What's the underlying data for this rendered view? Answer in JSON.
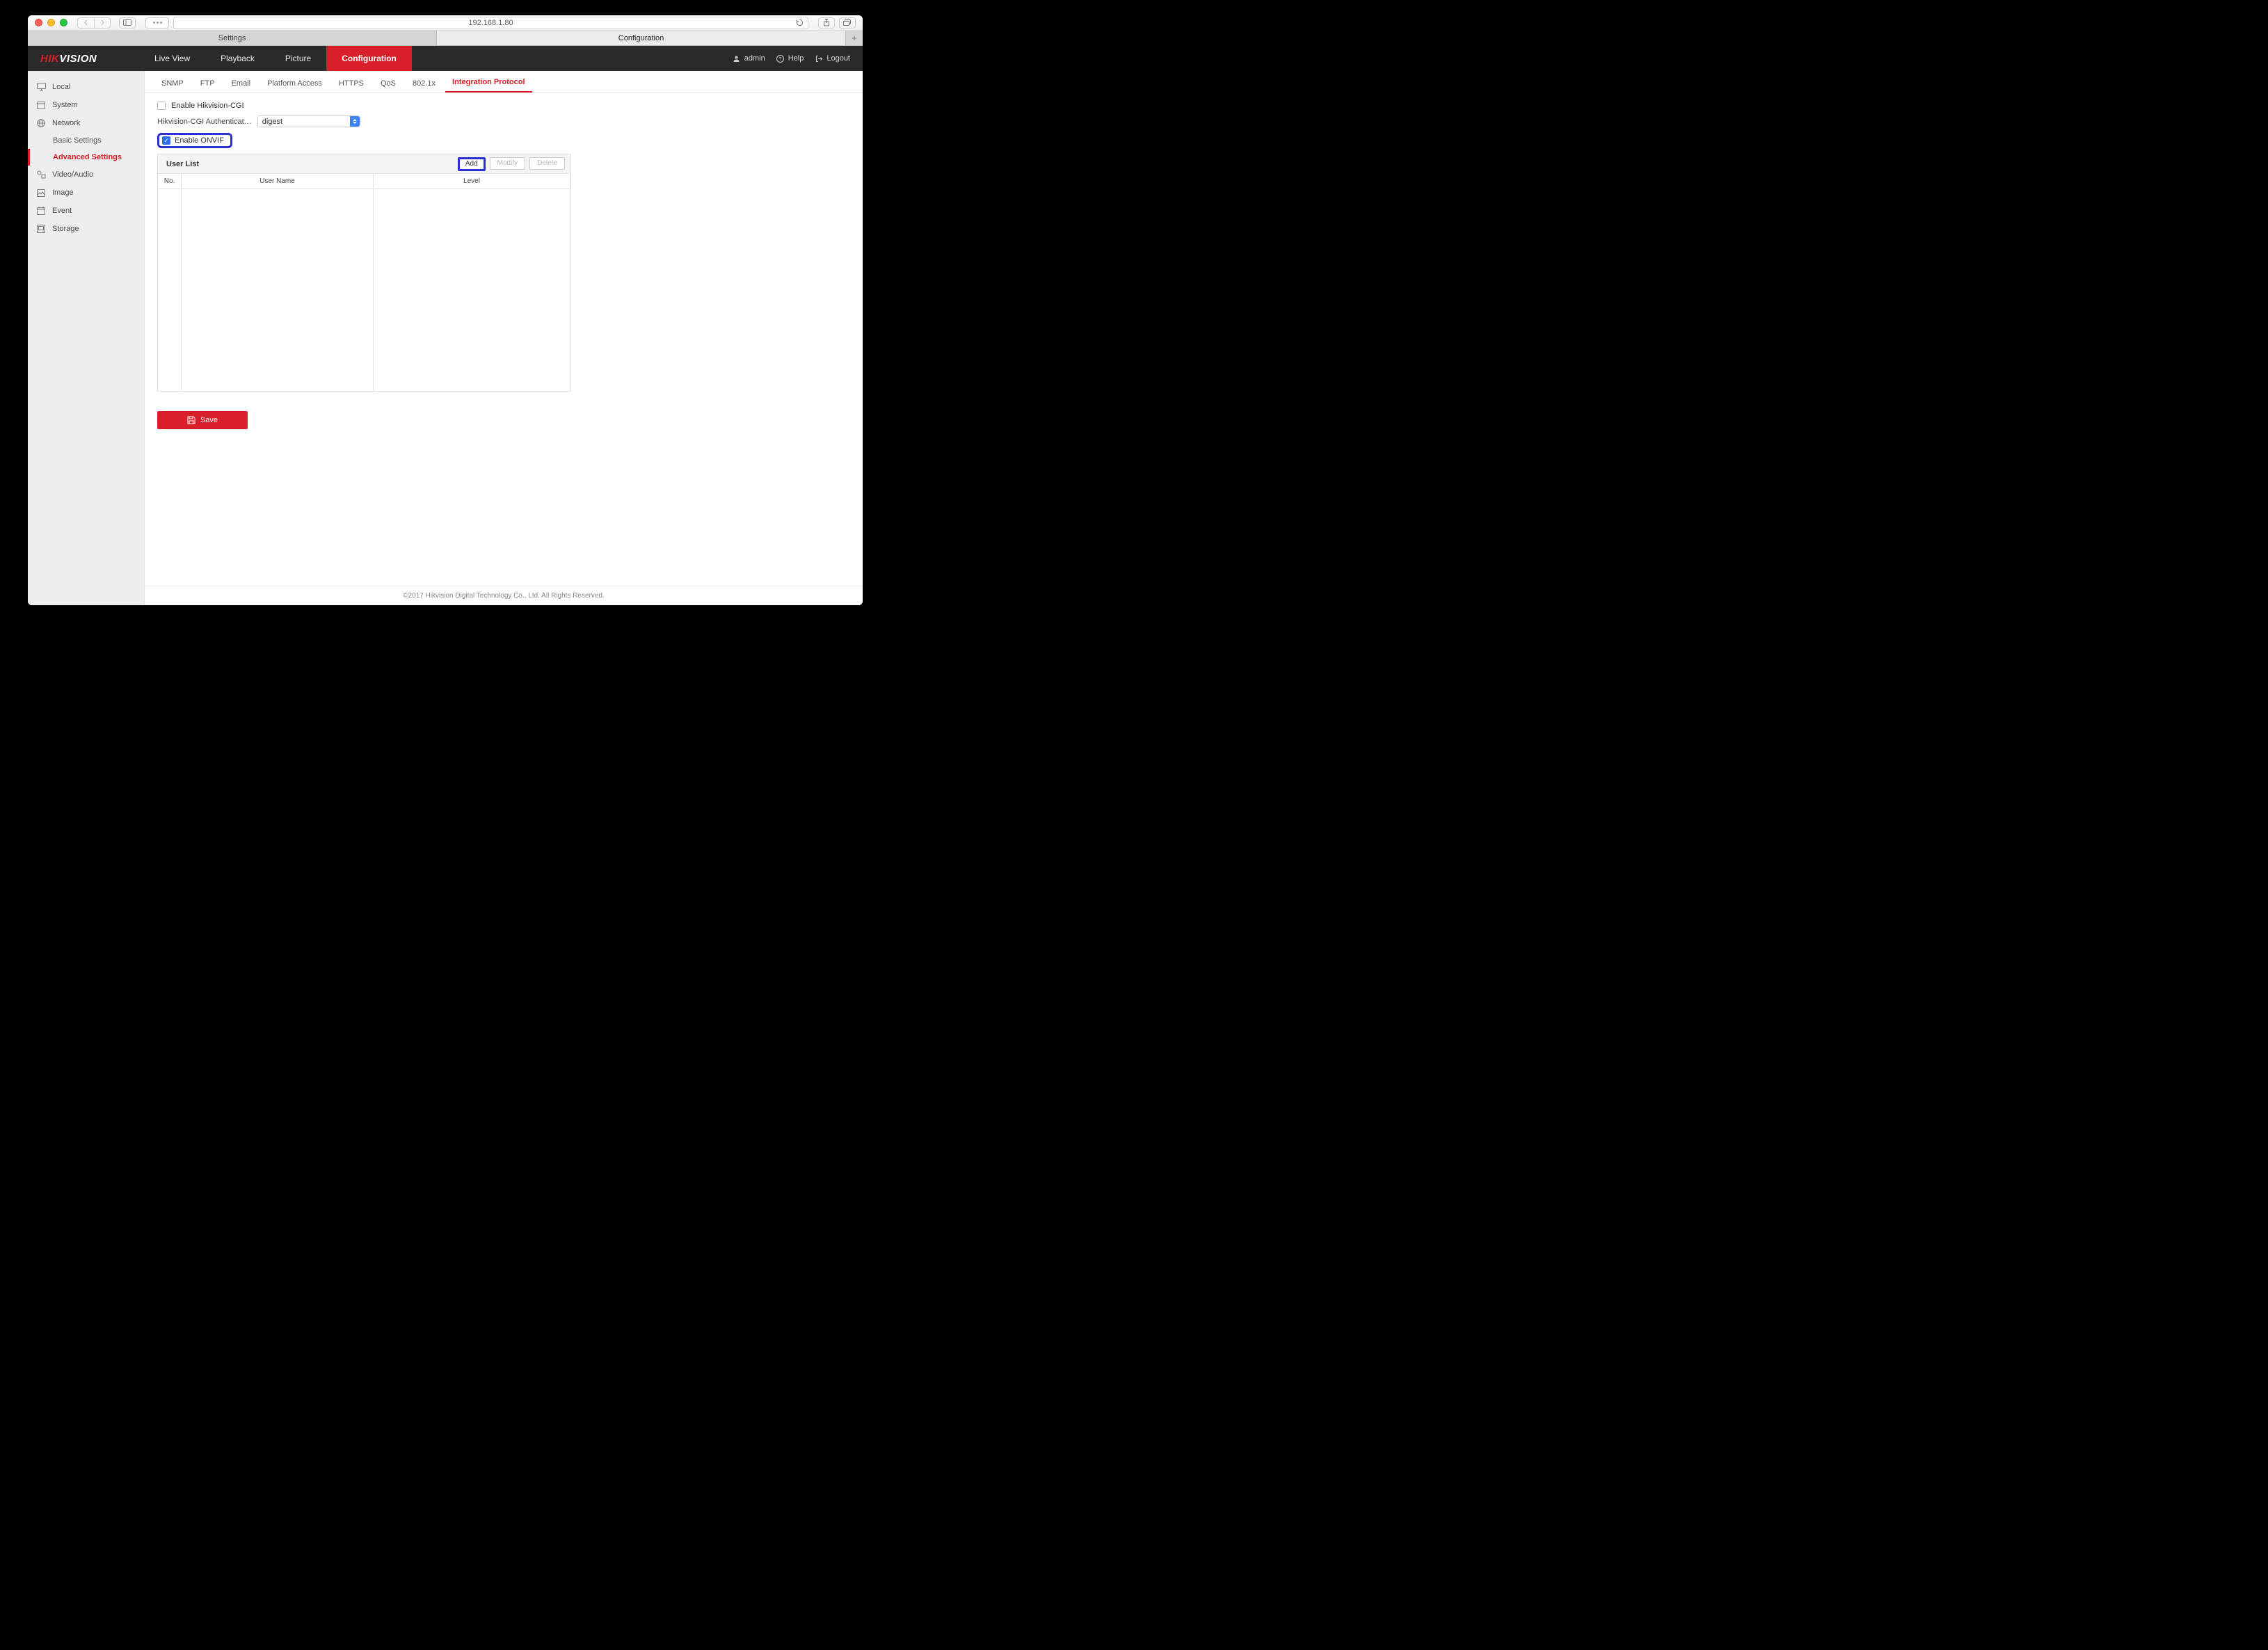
{
  "browser": {
    "address": "192.168.1.80",
    "tabs": [
      "Settings",
      "Configuration"
    ],
    "active_tab_index": 1
  },
  "brand": {
    "part1": "HIK",
    "part2": "VISION"
  },
  "topnav": {
    "items": [
      "Live View",
      "Playback",
      "Picture",
      "Configuration"
    ],
    "active_index": 3,
    "user": "admin",
    "help": "Help",
    "logout": "Logout"
  },
  "sidebar": {
    "items": [
      {
        "label": "Local",
        "icon": "monitor-icon"
      },
      {
        "label": "System",
        "icon": "window-icon"
      },
      {
        "label": "Network",
        "icon": "globe-icon",
        "children": [
          {
            "label": "Basic Settings"
          },
          {
            "label": "Advanced Settings",
            "active": true
          }
        ]
      },
      {
        "label": "Video/Audio",
        "icon": "av-icon"
      },
      {
        "label": "Image",
        "icon": "image-icon"
      },
      {
        "label": "Event",
        "icon": "calendar-icon"
      },
      {
        "label": "Storage",
        "icon": "storage-icon"
      }
    ]
  },
  "subtabs": {
    "items": [
      "SNMP",
      "FTP",
      "Email",
      "Platform Access",
      "HTTPS",
      "QoS",
      "802.1x",
      "Integration Protocol"
    ],
    "active_index": 7
  },
  "form": {
    "enable_cgi_label": "Enable Hikvision-CGI",
    "enable_cgi_checked": false,
    "auth_label": "Hikvision-CGI Authenticat…",
    "auth_value": "digest",
    "enable_onvif_label": "Enable ONVIF",
    "enable_onvif_checked": true
  },
  "userlist": {
    "title": "User List",
    "columns": [
      "No.",
      "User Name",
      "Level"
    ],
    "actions": {
      "add": "Add",
      "modify": "Modify",
      "delete": "Delete"
    },
    "rows": []
  },
  "save_label": "Save",
  "footer": "©2017 Hikvision Digital Technology Co., Ltd. All Rights Reserved."
}
